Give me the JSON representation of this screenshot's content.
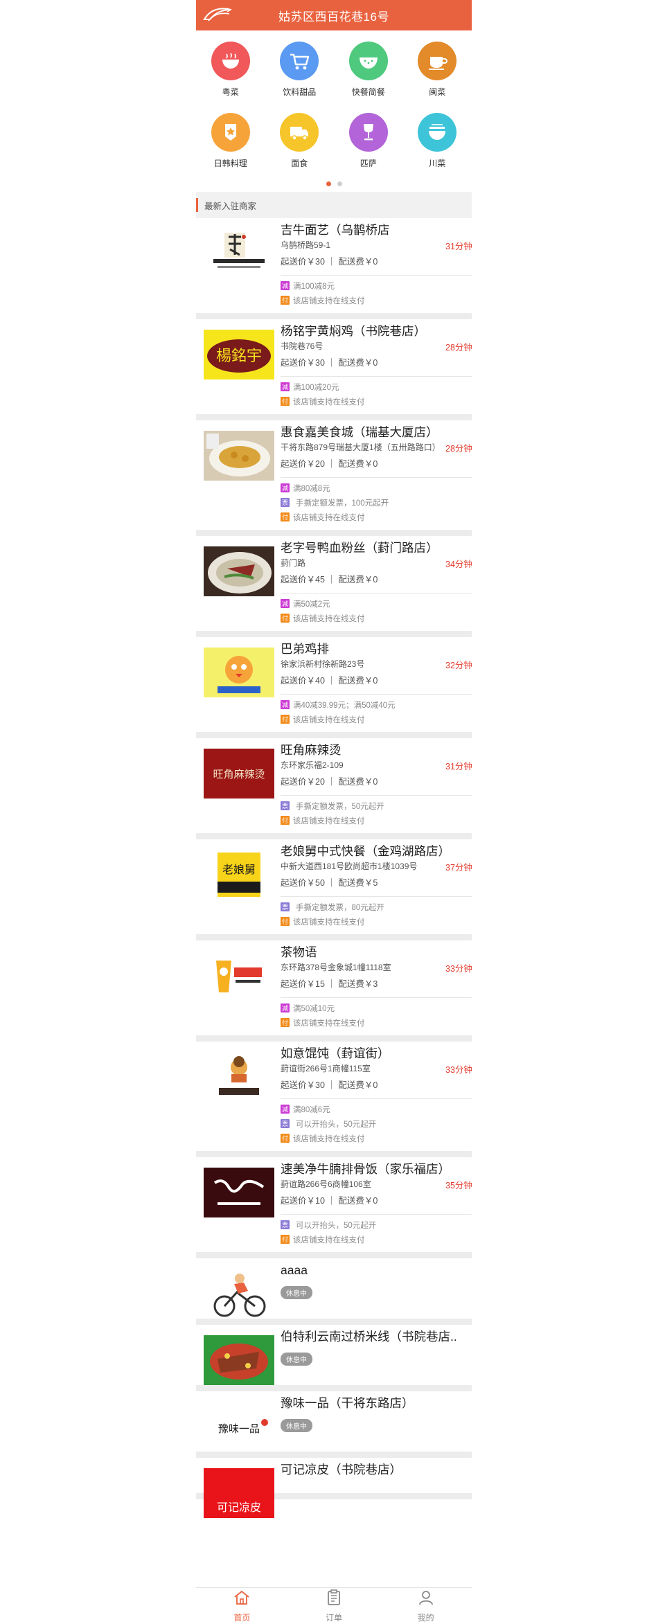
{
  "header": {
    "title": "姑苏区西百花巷16号",
    "accent": "#e9623f"
  },
  "categories": [
    {
      "label": "粤菜",
      "icon": "bowl-icon",
      "color": "#f0585a"
    },
    {
      "label": "饮料甜品",
      "icon": "cart-icon",
      "color": "#5a9af2"
    },
    {
      "label": "快餐简餐",
      "icon": "watermelon-icon",
      "color": "#4ec97e"
    },
    {
      "label": "闽菜",
      "icon": "cup-icon",
      "color": "#e38a2a"
    },
    {
      "label": "日韩料理",
      "icon": "star-badge-icon",
      "color": "#f6a43a"
    },
    {
      "label": "面食",
      "icon": "truck-icon",
      "color": "#f5c52a"
    },
    {
      "label": "匹萨",
      "icon": "wine-glass-icon",
      "color": "#b264d8"
    },
    {
      "label": "川菜",
      "icon": "noodle-bowl-icon",
      "color": "#3ec4d8"
    }
  ],
  "carousel": {
    "pages": 2,
    "active": 1
  },
  "section_title": "最新入驻商家",
  "shops": [
    {
      "name": "吉牛面艺（乌鹊桥店",
      "address": "乌鹊桥路59-1",
      "time": "31分钟",
      "min_order": "起送价￥30",
      "delivery": "配送费￥0",
      "promos": [
        {
          "tag": "减",
          "type": "jian",
          "text": "满100减8元"
        },
        {
          "tag": "付",
          "type": "fu",
          "text": "该店铺支持在线支付"
        }
      ]
    },
    {
      "name": "杨铭宇黄焖鸡（书院巷店）",
      "address": "书院巷76号",
      "time": "28分钟",
      "min_order": "起送价￥30",
      "delivery": "配送费￥0",
      "promos": [
        {
          "tag": "减",
          "type": "jian",
          "text": "满100减20元"
        },
        {
          "tag": "付",
          "type": "fu",
          "text": "该店铺支持在线支付"
        }
      ]
    },
    {
      "name": "惠食嘉美食城（瑞基大厦店）",
      "address": "干将东路879号瑞基大厦1楼（五卅路路口）",
      "time": "28分钟",
      "min_order": "起送价￥20",
      "delivery": "配送费￥0",
      "promos": [
        {
          "tag": "减",
          "type": "jian",
          "text": "满80减8元"
        },
        {
          "tag": "票",
          "type": "piao",
          "text": "手撕定额发票，100元起开",
          "gap": true
        },
        {
          "tag": "付",
          "type": "fu",
          "text": "该店铺支持在线支付"
        }
      ]
    },
    {
      "name": "老字号鸭血粉丝（葑门路店）",
      "address": "葑门路",
      "time": "34分钟",
      "min_order": "起送价￥45",
      "delivery": "配送费￥0",
      "promos": [
        {
          "tag": "减",
          "type": "jian",
          "text": "满50减2元"
        },
        {
          "tag": "付",
          "type": "fu",
          "text": "该店铺支持在线支付"
        }
      ]
    },
    {
      "name": "巴弟鸡排",
      "address": "徐家浜新村徐新路23号",
      "time": "32分钟",
      "min_order": "起送价￥40",
      "delivery": "配送费￥0",
      "promos": [
        {
          "tag": "减",
          "type": "jian",
          "text": "满40减39.99元；满50减40元"
        },
        {
          "tag": "付",
          "type": "fu",
          "text": "该店铺支持在线支付"
        }
      ]
    },
    {
      "name": "旺角麻辣烫",
      "address": "东环家乐福2-109",
      "time": "31分钟",
      "min_order": "起送价￥20",
      "delivery": "配送费￥0",
      "promos": [
        {
          "tag": "票",
          "type": "piao",
          "text": "手撕定额发票，50元起开",
          "gap": true
        },
        {
          "tag": "付",
          "type": "fu",
          "text": "该店铺支持在线支付"
        }
      ]
    },
    {
      "name": "老娘舅中式快餐（金鸡湖路店）",
      "address": "中新大道西181号欧尚超市1楼1039号",
      "time": "37分钟",
      "min_order": "起送价￥50",
      "delivery": "配送费￥5",
      "promos": [
        {
          "tag": "票",
          "type": "piao",
          "text": "手撕定额发票，80元起开",
          "gap": true
        },
        {
          "tag": "付",
          "type": "fu",
          "text": "该店铺支持在线支付"
        }
      ]
    },
    {
      "name": "茶物语",
      "address": "东环路378号金象城1幢1118室",
      "time": "33分钟",
      "min_order": "起送价￥15",
      "delivery": "配送费￥3",
      "promos": [
        {
          "tag": "减",
          "type": "jian",
          "text": "满50减10元"
        },
        {
          "tag": "付",
          "type": "fu",
          "text": "该店铺支持在线支付"
        }
      ]
    },
    {
      "name": "如意馄饨（葑谊街）",
      "address": "葑谊街266号1商幢115室",
      "time": "33分钟",
      "min_order": "起送价￥30",
      "delivery": "配送费￥0",
      "promos": [
        {
          "tag": "减",
          "type": "jian",
          "text": "满80减6元"
        },
        {
          "tag": "票",
          "type": "piao",
          "text": "可以开抬头，50元起开",
          "gap": true
        },
        {
          "tag": "付",
          "type": "fu",
          "text": "该店铺支持在线支付"
        }
      ]
    },
    {
      "name": "速美净牛腩排骨饭（家乐福店）",
      "address": "葑谊路266号6商幢106室",
      "time": "35分钟",
      "min_order": "起送价￥10",
      "delivery": "配送费￥0",
      "promos": [
        {
          "tag": "票",
          "type": "piao",
          "text": "可以开抬头，50元起开",
          "gap": true
        },
        {
          "tag": "付",
          "type": "fu",
          "text": "该店铺支持在线支付"
        }
      ]
    },
    {
      "name": "aaaa",
      "closed_label": "休息中"
    },
    {
      "name": "伯特利云南过桥米线（书院巷店..",
      "closed_label": "休息中"
    },
    {
      "name": "豫味一品（干将东路店）",
      "closed_label": "休息中"
    },
    {
      "name": "可记凉皮（书院巷店）"
    }
  ],
  "bottom_nav": [
    {
      "label": "首页",
      "icon": "home-icon",
      "active": true
    },
    {
      "label": "订单",
      "icon": "order-icon",
      "active": false
    },
    {
      "label": "我的",
      "icon": "user-icon",
      "active": false
    }
  ]
}
